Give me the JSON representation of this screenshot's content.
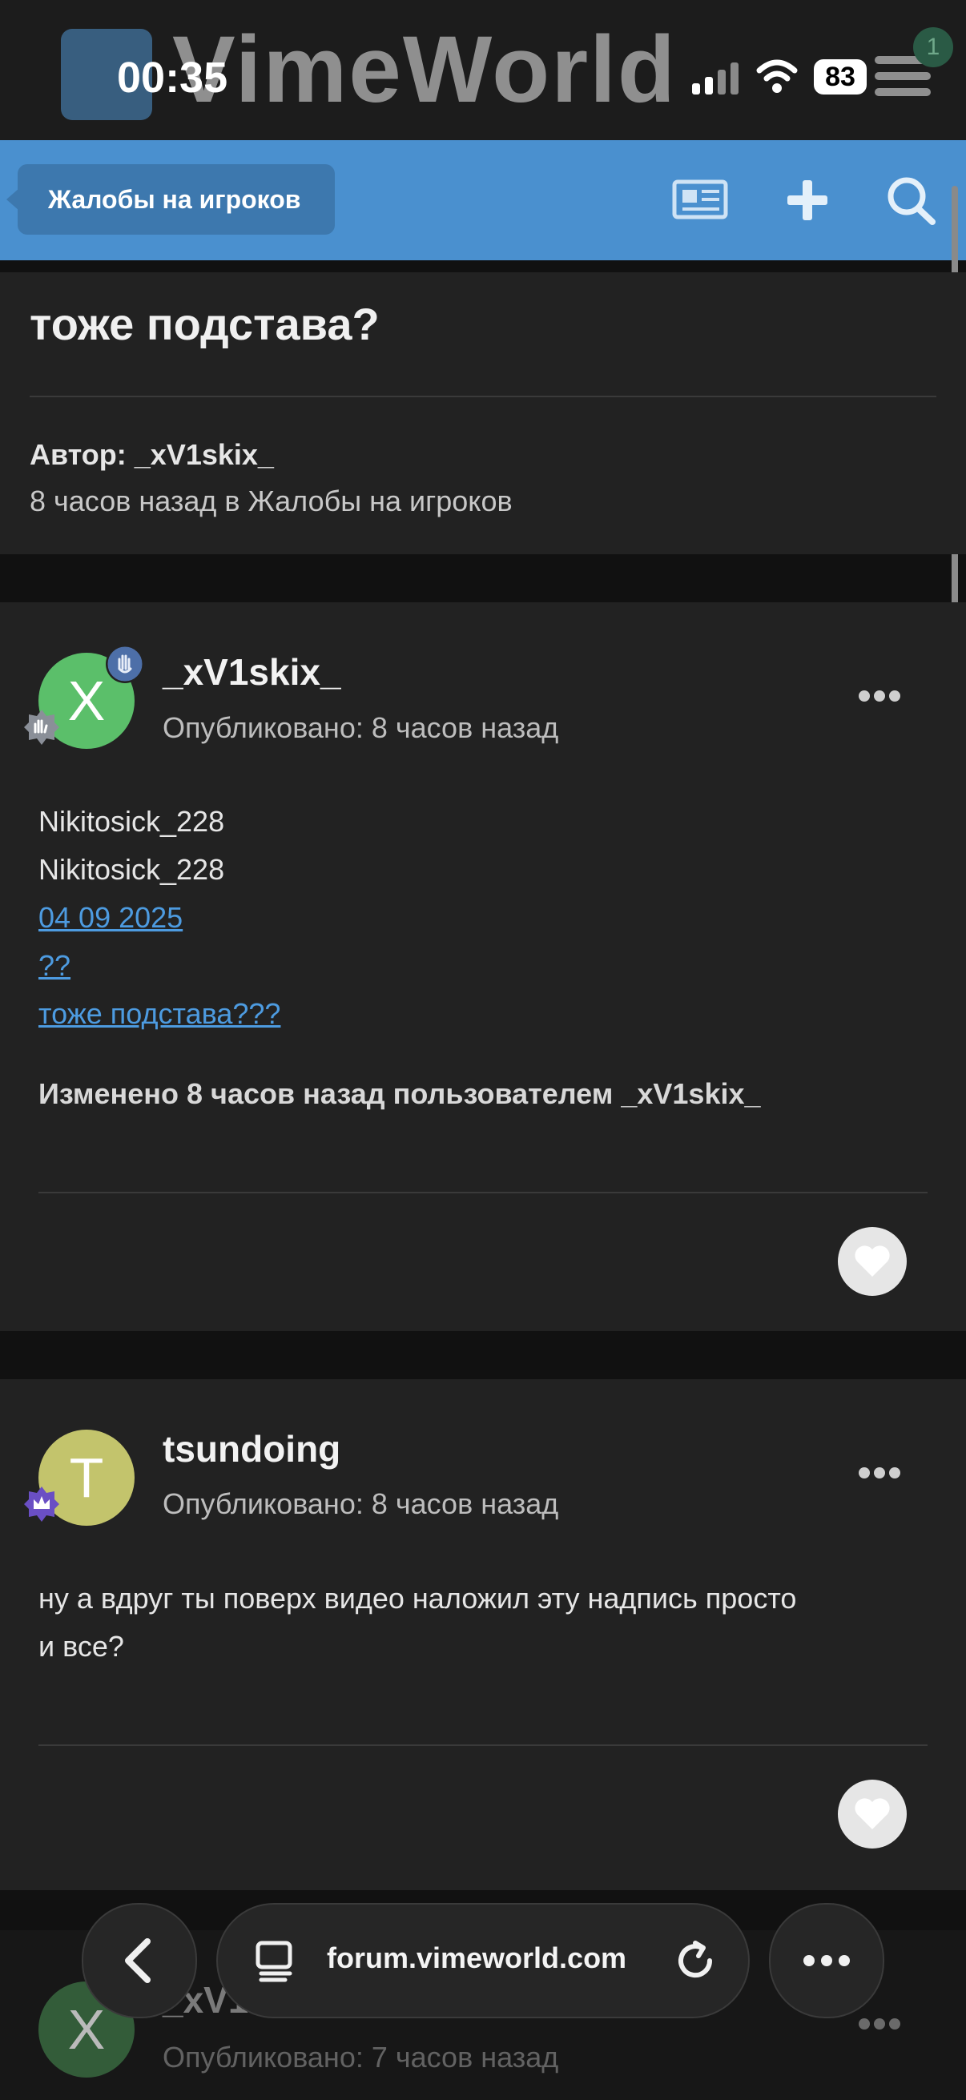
{
  "status": {
    "time": "00:35",
    "battery": "83"
  },
  "header": {
    "logo_text": "VimeWorld",
    "notification_count": "1"
  },
  "nav": {
    "breadcrumb": "Жалобы на игроков",
    "icons": [
      "news-icon",
      "plus-icon",
      "search-icon"
    ]
  },
  "topic": {
    "title": "тоже подстава?",
    "author_line": "Автор: _xV1skix_",
    "meta_line": "8 часов назад в Жалобы на игроков"
  },
  "posts": [
    {
      "avatar_letter": "X",
      "avatar_color": "#5bbf6a",
      "username": "_xV1skix_",
      "posted": "Опубликовано: 8 часов назад",
      "lines": [
        {
          "text": "Nikitosick_228",
          "link": false
        },
        {
          "text": "Nikitosick_228",
          "link": false
        },
        {
          "text": "04 09 2025",
          "link": true
        },
        {
          "text": "??",
          "link": true
        },
        {
          "text": "тоже подстава???",
          "link": true
        }
      ],
      "edited": "Изменено 8 часов назад пользователем _xV1skix_"
    },
    {
      "avatar_letter": "T",
      "avatar_color": "#c3c46c",
      "username": "tsundoing",
      "posted": "Опубликовано: 8 часов назад",
      "lines": [
        {
          "text": "ну а вдруг ты поверх видео наложил эту надпись просто",
          "link": false
        },
        {
          "text": "и все?",
          "link": false
        }
      ]
    },
    {
      "avatar_letter": "X",
      "avatar_color": "#5bbf6a",
      "username": "_xV1skix_",
      "posted": "Опубликовано: 7 часов назад"
    }
  ],
  "browser": {
    "url": "forum.vimeworld.com"
  },
  "colors": {
    "accent": "#4a90cf",
    "link": "#4d9be0",
    "card": "#222222",
    "background": "#111111"
  }
}
